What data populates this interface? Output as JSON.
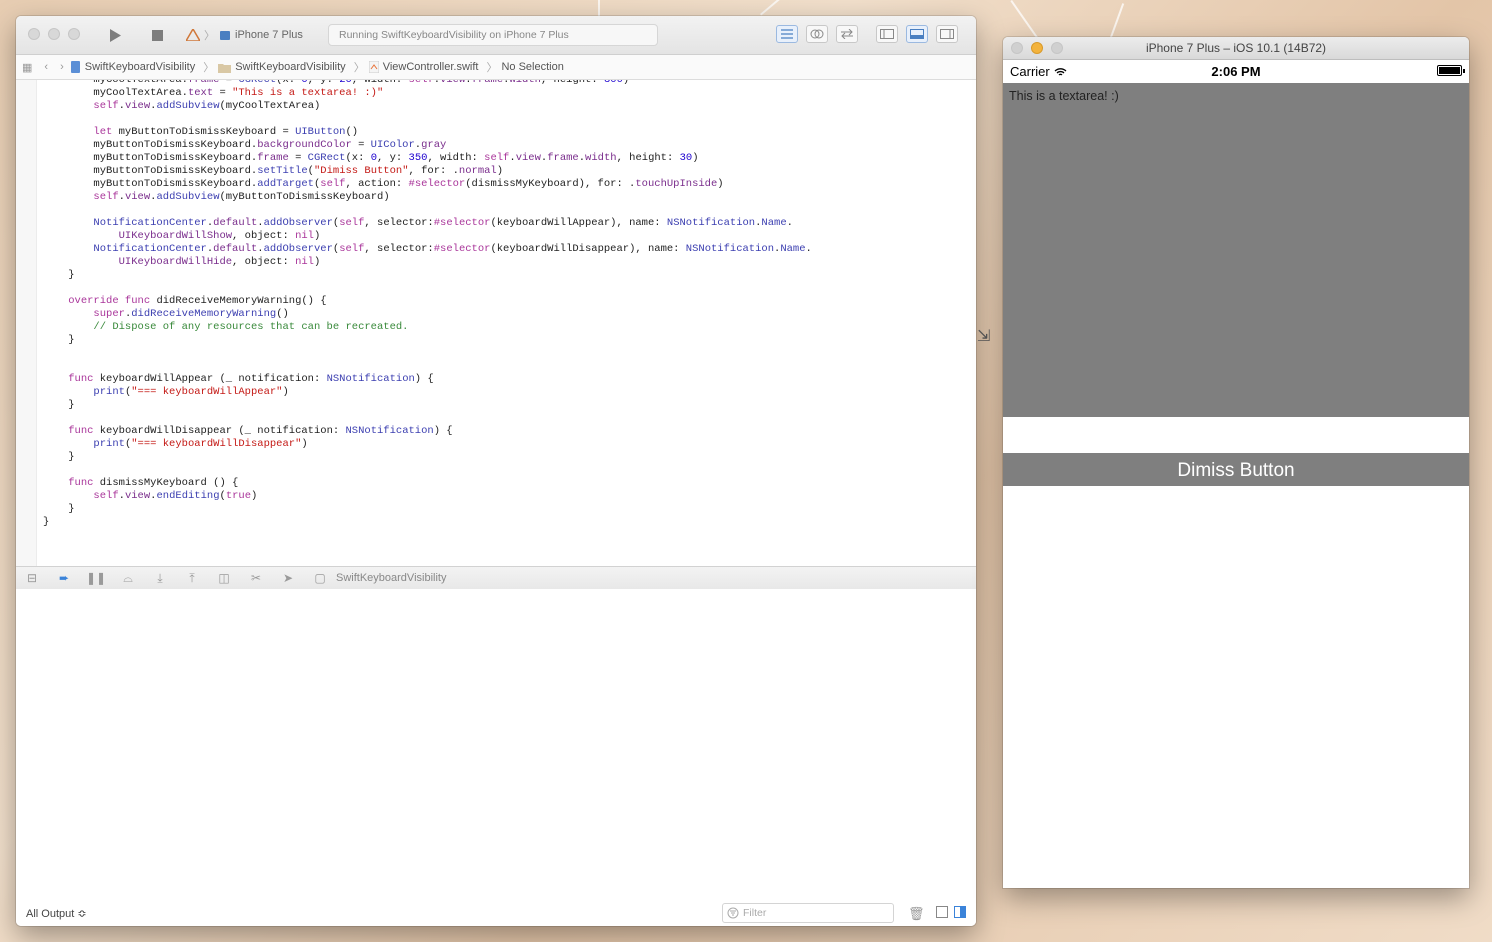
{
  "xcode": {
    "toolbar": {
      "scheme_device": "iPhone 7 Plus",
      "activity_text": "Running SwiftKeyboardVisibility on iPhone 7 Plus"
    },
    "jumpbar": {
      "crumbs": [
        "SwiftKeyboardVisibility",
        "SwiftKeyboardVisibility",
        "ViewController.swift",
        "No Selection"
      ]
    },
    "debug": {
      "process_label": "SwiftKeyboardVisibility"
    },
    "console": {
      "output_selector": "All Output ≎",
      "filter_placeholder": "Filter"
    }
  },
  "simulator": {
    "title": "iPhone 7 Plus – iOS 10.1 (14B72)",
    "carrier": "Carrier",
    "time": "2:06 PM",
    "textarea_text": "This is a textarea! :)",
    "button_label": "Dimiss Button",
    "textarea_color": "#7f7f7f",
    "button_color": "#7f7f7f"
  },
  "icons": [
    "run-icon",
    "stop-icon",
    "scheme-icon",
    "device-icon",
    "grid-icon",
    "back-icon",
    "forward-icon",
    "folder-icon",
    "swift-file-icon",
    "wifi-icon",
    "battery-icon",
    "trash-icon",
    "filter-icon"
  ]
}
